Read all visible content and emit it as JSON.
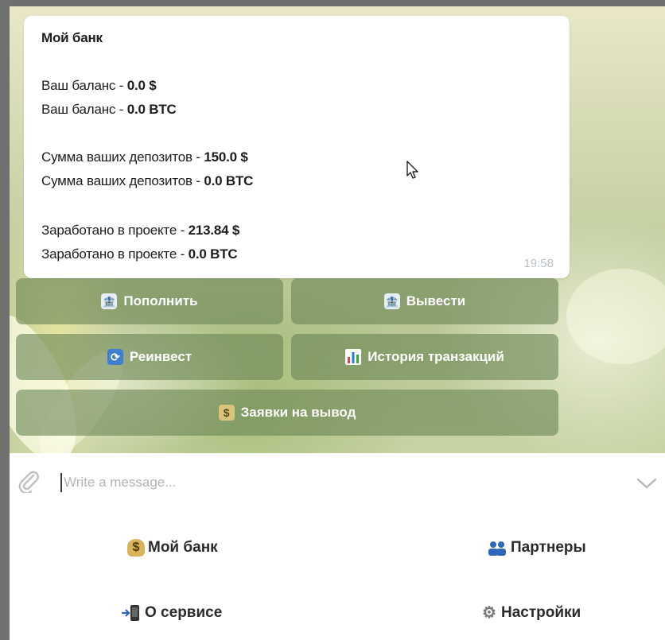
{
  "message": {
    "title": "Мой банк",
    "lines": [
      {
        "label": "Ваш баланс - ",
        "value": "0.0 $"
      },
      {
        "label": "Ваш баланс - ",
        "value": "0.0 BTC"
      },
      {
        "label": "Сумма ваших депозитов - ",
        "value": "150.0 $"
      },
      {
        "label": "Сумма ваших депозитов - ",
        "value": "0.0 BTC"
      },
      {
        "label": "Заработано в проекте - ",
        "value": "213.84 $"
      },
      {
        "label": "Заработано в проекте - ",
        "value": "0.0 BTC"
      }
    ],
    "time": "19:58"
  },
  "inline_buttons": [
    {
      "label": "Пополнить",
      "icon": "bank-icon"
    },
    {
      "label": "Вывести",
      "icon": "bank-icon"
    },
    {
      "label": "Реинвест",
      "icon": "refresh-icon"
    },
    {
      "label": "История транзакций",
      "icon": "bar-chart-icon"
    },
    {
      "label": "Заявки на вывод",
      "icon": "money-wings-icon"
    }
  ],
  "composer": {
    "placeholder": "Write a message..."
  },
  "keyboard": [
    {
      "label": "Мой банк",
      "icon": "money-bag-icon"
    },
    {
      "label": "Партнеры",
      "icon": "people-icon"
    },
    {
      "label": "О сервисе",
      "icon": "mobile-arrow-icon"
    },
    {
      "label": "Настройки",
      "icon": "gear-icon"
    }
  ],
  "colors": {
    "button_bg": "#6c8656",
    "bubble_bg": "#ffffff",
    "time": "#b9c0c6"
  }
}
